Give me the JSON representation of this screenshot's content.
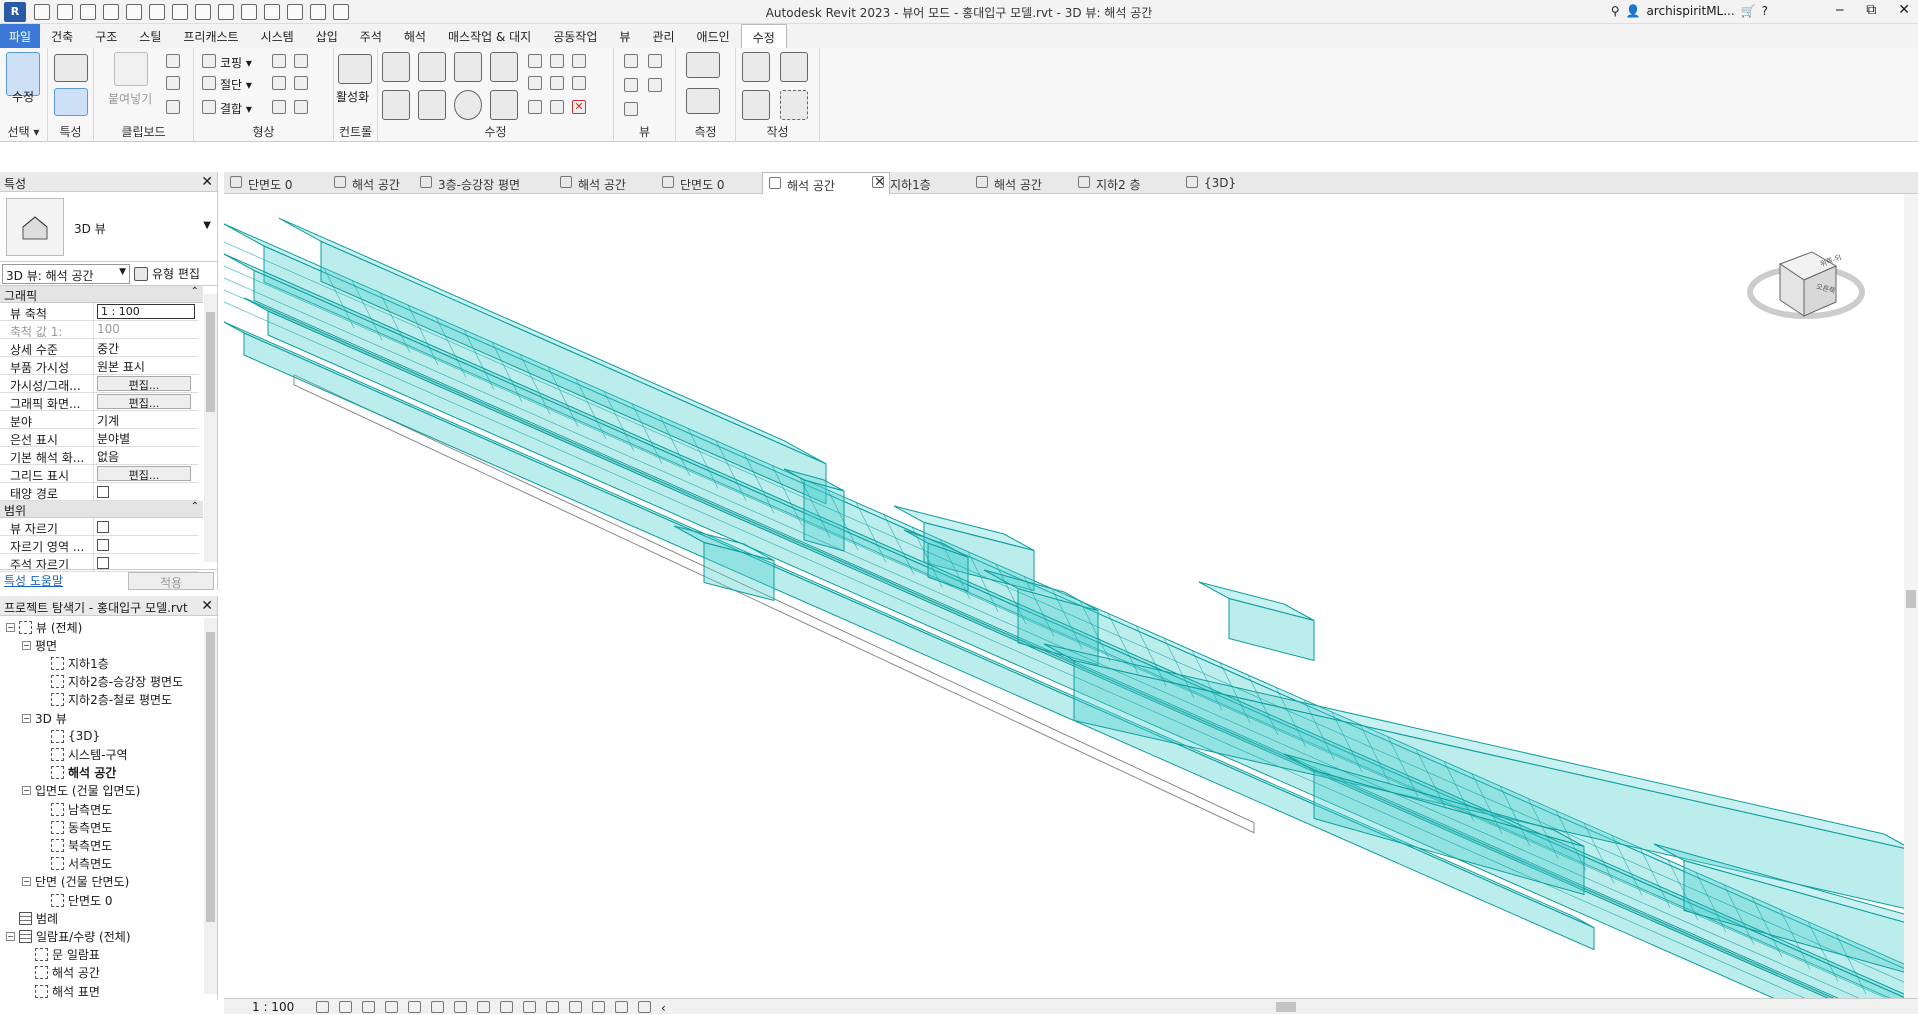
{
  "window": {
    "title": "Autodesk Revit 2023 - 뷰어 모드 - 홍대입구 모델.rvt - 3D 뷰: 해석 공간",
    "app_icon": "R",
    "user": "archispiritML...",
    "minimize": "‒",
    "restore": "⧉",
    "close": "✕"
  },
  "ribbon_tabs": [
    "파일",
    "건축",
    "구조",
    "스틸",
    "프리캐스트",
    "시스템",
    "삽입",
    "주석",
    "해석",
    "매스작업 & 대지",
    "공동작업",
    "뷰",
    "관리",
    "애드인",
    "수정"
  ],
  "ribbon": {
    "select": {
      "big_label": "수정",
      "panel": "선택 ▾"
    },
    "properties": {
      "panel": "특성"
    },
    "clipboard": {
      "paste": "붙여넣기",
      "panel": "클립보드"
    },
    "geometry": {
      "cope": "코핑 ▾",
      "cut": "절단 ▾",
      "join": "결합 ▾",
      "panel": "형상"
    },
    "controls": {
      "activate": "활성화",
      "panel": "컨트롤"
    },
    "modify": {
      "panel": "수정"
    },
    "view": {
      "panel": "뷰"
    },
    "measure": {
      "panel": "측정"
    },
    "create": {
      "panel": "작성"
    }
  },
  "view_tabs": [
    {
      "label": "단면도 0",
      "icon": "section-icon"
    },
    {
      "label": "해석 공간",
      "icon": "3d-view-icon"
    },
    {
      "label": "3층-승강장 평면도",
      "icon": "floor-plan-icon"
    },
    {
      "label": "해석 공간",
      "icon": "3d-view-icon"
    },
    {
      "label": "단면도 0",
      "icon": "section-icon"
    },
    {
      "label": "해석 공간",
      "icon": "3d-view-icon",
      "active": true
    },
    {
      "label": "지하1층",
      "icon": "floor-plan-icon"
    },
    {
      "label": "해석 공간",
      "icon": "schedule-icon"
    },
    {
      "label": "지하2 층",
      "icon": "floor-plan-icon"
    },
    {
      "label": "{3D}",
      "icon": "3d-view-icon"
    }
  ],
  "properties": {
    "title": "특성",
    "type_name": "3D 뷰",
    "instance_selector": "3D 뷰: 해석 공간",
    "edit_type": "유형 편집",
    "sections": [
      {
        "name": "그래픽",
        "rows": [
          {
            "name": "뷰 축척",
            "value": "1 : 100",
            "kind": "input"
          },
          {
            "name": "축척 값    1:",
            "value": "100",
            "kind": "disabled"
          },
          {
            "name": "상세 수준",
            "value": "중간"
          },
          {
            "name": "부품 가시성",
            "value": "원본 표시"
          },
          {
            "name": "가시성/그래...",
            "value": "편집...",
            "kind": "button"
          },
          {
            "name": "그래픽 화면...",
            "value": "편집...",
            "kind": "button"
          },
          {
            "name": "분야",
            "value": "기계"
          },
          {
            "name": "은선 표시",
            "value": "분야별"
          },
          {
            "name": "기본 해석 화...",
            "value": "없음"
          },
          {
            "name": "그리드 표시",
            "value": "편집...",
            "kind": "button"
          },
          {
            "name": "태양 경로",
            "value": "",
            "kind": "checkbox"
          }
        ]
      },
      {
        "name": "범위",
        "rows": [
          {
            "name": "뷰 자르기",
            "value": "",
            "kind": "checkbox"
          },
          {
            "name": "자르기 영역 ...",
            "value": "",
            "kind": "checkbox"
          },
          {
            "name": "주석 자르기",
            "value": "",
            "kind": "checkbox"
          }
        ]
      }
    ],
    "help_link": "특성 도움말",
    "apply": "적용"
  },
  "browser": {
    "title": "프로젝트 탐색기 - 홍대입구 모델.rvt",
    "items": [
      {
        "label": "뷰 (전체)",
        "level": 0,
        "exp": "⊟",
        "icon": "views"
      },
      {
        "label": "평면",
        "level": 1,
        "exp": "⊟"
      },
      {
        "label": "지하1층",
        "level": 2
      },
      {
        "label": "지하2층-승강장 평면도",
        "level": 2
      },
      {
        "label": "지하2층-철로 평면도",
        "level": 2
      },
      {
        "label": "3D 뷰",
        "level": 1,
        "exp": "⊟"
      },
      {
        "label": "{3D}",
        "level": 2
      },
      {
        "label": "시스템-구역",
        "level": 2
      },
      {
        "label": "해석 공간",
        "level": 2,
        "bold": true
      },
      {
        "label": "입면도 (건물 입면도)",
        "level": 1,
        "exp": "⊟"
      },
      {
        "label": "남측면도",
        "level": 2
      },
      {
        "label": "동측면도",
        "level": 2
      },
      {
        "label": "북측면도",
        "level": 2
      },
      {
        "label": "서측면도",
        "level": 2
      },
      {
        "label": "단면 (건물 단면도)",
        "level": 1,
        "exp": "⊟"
      },
      {
        "label": "단면도 0",
        "level": 2
      },
      {
        "label": "범례",
        "level": 0,
        "icon": "table"
      },
      {
        "label": "일람표/수량 (전체)",
        "level": 0,
        "exp": "⊟",
        "icon": "table"
      },
      {
        "label": "문 일람표",
        "level": 1
      },
      {
        "label": "해석 공간",
        "level": 1
      },
      {
        "label": "해석 표면",
        "level": 1
      }
    ]
  },
  "viewcube": {
    "top_text": "위쪽-뒤",
    "front_text": "오른쪽"
  },
  "status": {
    "scale": "1 : 100"
  },
  "colors": {
    "model_fill": "#4ecfcf",
    "model_stroke": "#0e9e9e",
    "accent": "#3c78d8"
  }
}
